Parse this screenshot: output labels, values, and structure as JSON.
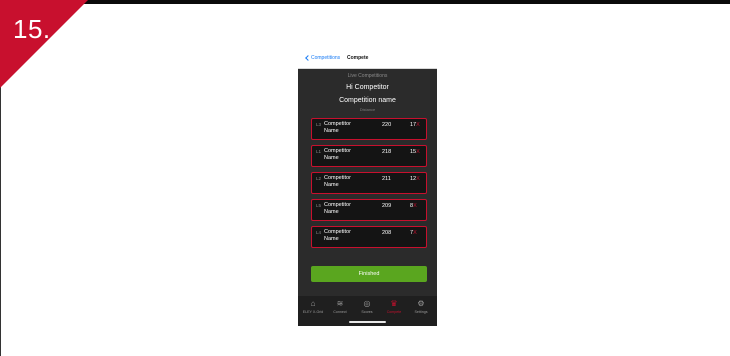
{
  "step": {
    "label": "15."
  },
  "navbar": {
    "back_label": "Competitions",
    "title": "Compete"
  },
  "header": {
    "subtitle": "Live Competitions",
    "greeting": "Hi Competitor",
    "competition_name": "Competition name",
    "distance": "Distance"
  },
  "competitors": [
    {
      "lane": "L3",
      "name": "Competitor Name",
      "score": "220",
      "x_count": "17",
      "x_mark": "X"
    },
    {
      "lane": "L1",
      "name": "Competitor Name",
      "score": "218",
      "x_count": "15",
      "x_mark": "X"
    },
    {
      "lane": "L2",
      "name": "Competitor Name",
      "score": "211",
      "x_count": "12",
      "x_mark": "X"
    },
    {
      "lane": "L5",
      "name": "Competitor Name",
      "score": "209",
      "x_count": "8",
      "x_mark": "X"
    },
    {
      "lane": "L4",
      "name": "Competitor Name",
      "score": "208",
      "x_count": "7",
      "x_mark": "X"
    }
  ],
  "finished_button": {
    "label": "Finished"
  },
  "tabs": [
    {
      "label": "ELEY X-Grid",
      "icon": "home-icon"
    },
    {
      "label": "Connect",
      "icon": "wifi-icon"
    },
    {
      "label": "Scores",
      "icon": "target-icon"
    },
    {
      "label": "Compete",
      "icon": "trophy-icon"
    },
    {
      "label": "Settings",
      "icon": "gear-icon"
    }
  ],
  "colors": {
    "accent": "#c8102e",
    "finished": "#5aa61f",
    "link": "#1a7cf5",
    "app_bg": "#2b2b2b"
  }
}
